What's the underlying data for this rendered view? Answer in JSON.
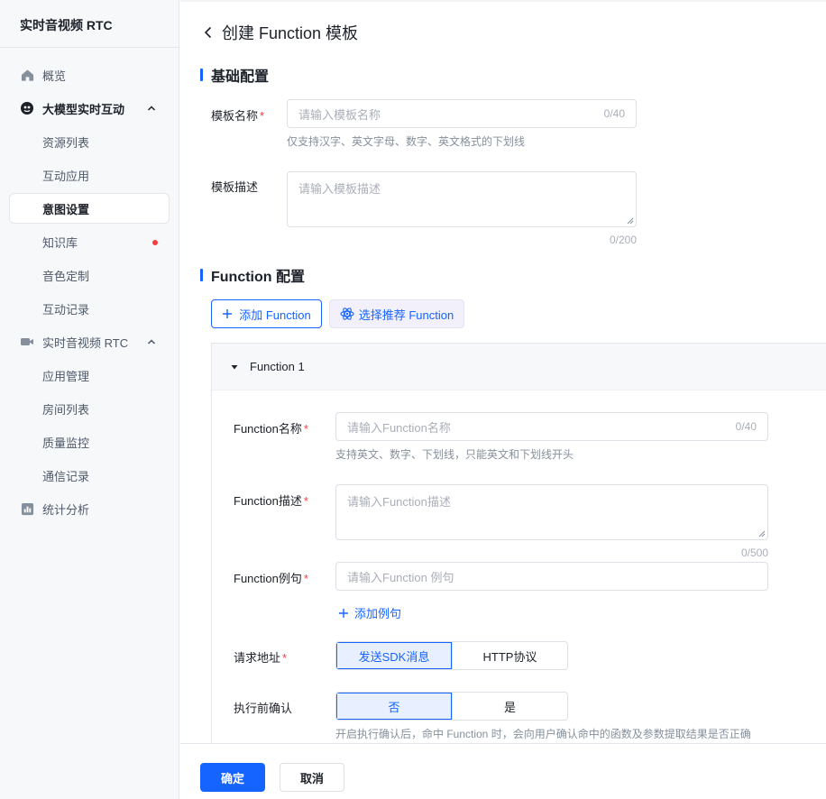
{
  "sidebar": {
    "title": "实时音视频 RTC",
    "items": [
      {
        "label": "概览"
      },
      {
        "label": "大模型实时互动"
      },
      {
        "label": "资源列表"
      },
      {
        "label": "互动应用"
      },
      {
        "label": "意图设置"
      },
      {
        "label": "知识库"
      },
      {
        "label": "音色定制"
      },
      {
        "label": "互动记录"
      },
      {
        "label": "实时音视频 RTC"
      },
      {
        "label": "应用管理"
      },
      {
        "label": "房间列表"
      },
      {
        "label": "质量监控"
      },
      {
        "label": "通信记录"
      },
      {
        "label": "统计分析"
      }
    ]
  },
  "header": {
    "title": "创建 Function 模板"
  },
  "basic": {
    "section_title": "基础配置",
    "name_label": "模板名称",
    "name_placeholder": "请输入模板名称",
    "name_count": "0/40",
    "name_hint": "仅支持汉字、英文字母、数字、英文格式的下划线",
    "desc_label": "模板描述",
    "desc_placeholder": "请输入模板描述",
    "desc_count": "0/200"
  },
  "function": {
    "section_title": "Function 配置",
    "add_button": "添加 Function",
    "recommend_button": "选择推荐 Function",
    "panel_title": "Function 1",
    "name_label": "Function名称",
    "name_placeholder": "请输入Function名称",
    "name_count": "0/40",
    "name_hint": "支持英文、数字、下划线，只能英文和下划线开头",
    "desc_label": "Function描述",
    "desc_placeholder": "请输入Function描述",
    "desc_count": "0/500",
    "example_label": "Function例句",
    "example_placeholder": "请输入Function 例句",
    "add_example": "添加例句",
    "url_label": "请求地址",
    "url_options": [
      "发送SDK消息",
      "HTTP协议"
    ],
    "confirm_label": "执行前确认",
    "confirm_options": [
      "否",
      "是"
    ],
    "confirm_hint": "开启执行确认后，命中 Function 时，会向用户确认命中的函数及参数提取结果是否正确"
  },
  "footer": {
    "ok": "确定",
    "cancel": "取消"
  },
  "colors": {
    "primary": "#1664ff",
    "required": "#f53f3f"
  }
}
